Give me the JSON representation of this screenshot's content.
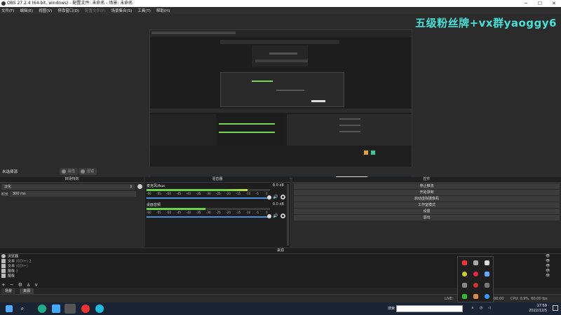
{
  "window": {
    "title": "OBS 27.2.4 (64-bit, windows) - 配置文件: 未命名 - 场景: 未命名",
    "controls": [
      "─",
      "☐",
      "✕"
    ]
  },
  "menu": {
    "items": [
      "文件(F)",
      "编辑(E)",
      "视图(V)",
      "停靠窗口(D)",
      "配置文件(P)",
      "场景集合(S)",
      "工具(T)",
      "帮助(H)"
    ],
    "disabled_index": 4
  },
  "watermark": "五级粉丝牌+vx群yaoggy6",
  "scene_bar": {
    "label": "未选择源",
    "properties_label": "属性",
    "filters_label": "滤镜"
  },
  "docks": {
    "filters": {
      "title": "转场特效",
      "transition": "淡化",
      "duration_label": "时长",
      "duration_value": "300 ms"
    },
    "mixer": {
      "title": "混音器",
      "tracks": [
        {
          "name": "麦克风/Aux",
          "db": "0.0 dB",
          "level": 0.82
        },
        {
          "name": "桌面音频",
          "db": "0.0 dB",
          "level": 0.48
        }
      ],
      "scale_ticks": [
        "-60",
        "-55",
        "-50",
        "-45",
        "-40",
        "-35",
        "-30",
        "-25",
        "-20",
        "-15",
        "-10",
        "-5",
        "0"
      ]
    },
    "controls": {
      "title": "控件",
      "buttons": [
        "停止推流",
        "开始录制",
        "启动虚拟摄像机",
        "工作室模式",
        "设置",
        "退出"
      ]
    }
  },
  "sources": {
    "title": "来源",
    "items": [
      {
        "name": "浏览器",
        "icon": "browser-icon"
      },
      {
        "name": "文本",
        "detail": "(GDI+) 2",
        "icon": "text-icon"
      },
      {
        "name": "文本",
        "detail": "(GDI+)",
        "icon": "text-icon"
      },
      {
        "name": "图像",
        "detail": "2",
        "icon": "image-icon"
      },
      {
        "name": "图像",
        "icon": "image-icon"
      }
    ],
    "toolbar": [
      "+",
      "−",
      "⚙",
      "∧",
      "∨"
    ]
  },
  "dock_tabs": [
    "场景",
    "来源"
  ],
  "status": {
    "live": "LIVE:",
    "time": "00:00",
    "cpu": "CPU: 0.9%, 60.00 fps"
  },
  "taskbar": {
    "search_label": "搜索",
    "time": "17:59",
    "date": "2022/12/5"
  },
  "colors": {
    "meter_green": "#6bd44a",
    "meter_yellow": "#d8d84a",
    "meter_red": "#d84a4a",
    "slider_blue": "#4a8fd9",
    "watermark": "#48e0d6"
  }
}
